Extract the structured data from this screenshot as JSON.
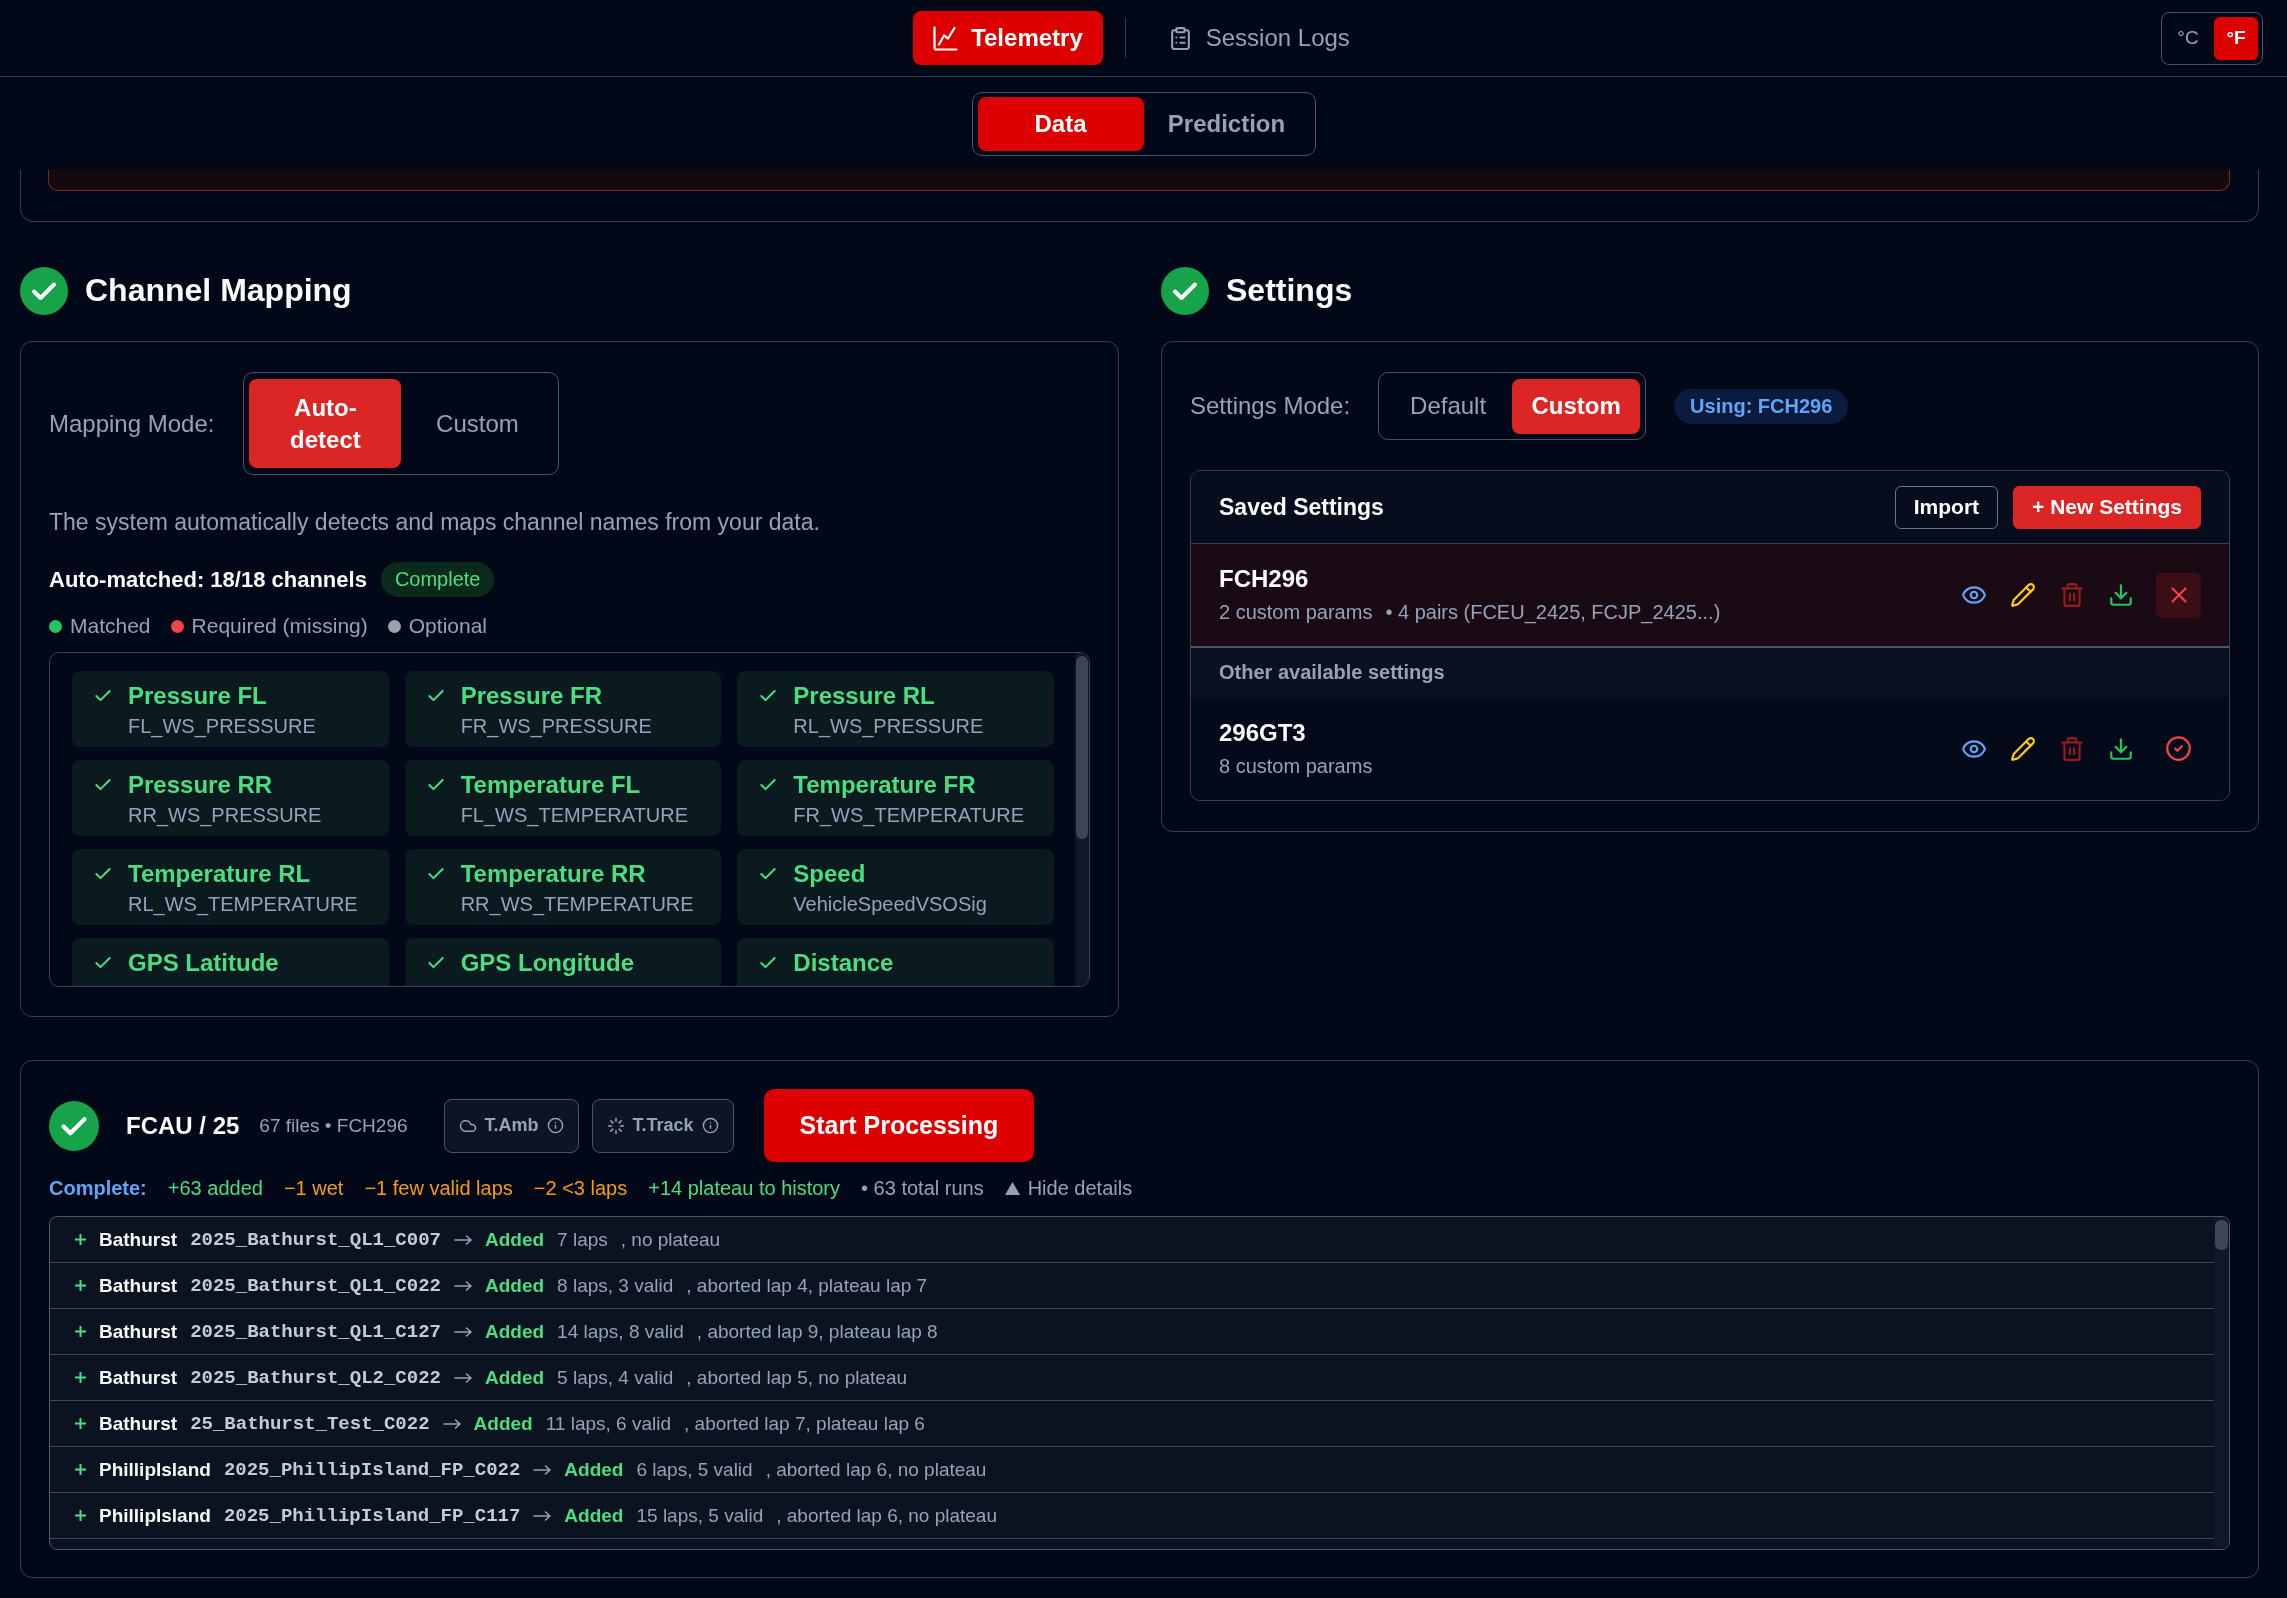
{
  "nav": [
    {
      "label": "Telemetry",
      "selected": true
    },
    {
      "label": "Session Logs",
      "selected": false
    }
  ],
  "units": [
    {
      "label": "°C",
      "selected": false
    },
    {
      "label": "°F",
      "selected": true
    }
  ],
  "view_tabs": [
    {
      "label": "Data",
      "selected": true
    },
    {
      "label": "Prediction",
      "selected": false
    }
  ],
  "channel_mapping": {
    "title": "Channel Mapping",
    "complete": true,
    "mode_label": "Mapping Mode:",
    "modes": [
      {
        "label": "Auto-detect",
        "selected": true
      },
      {
        "label": "Custom",
        "selected": false
      }
    ],
    "description": "The system automatically detects and maps channel names from your data.",
    "summary": "Auto-matched: 18/18 channels",
    "badge": "Complete",
    "legend": [
      {
        "label": "Matched",
        "color": "#22c55e"
      },
      {
        "label": "Required (missing)",
        "color": "#ef4444"
      },
      {
        "label": "Optional",
        "color": "#9ca3af"
      }
    ],
    "channels": [
      {
        "name": "Pressure FL",
        "source": "FL_WS_PRESSURE",
        "matched": true
      },
      {
        "name": "Pressure FR",
        "source": "FR_WS_PRESSURE",
        "matched": true
      },
      {
        "name": "Pressure RL",
        "source": "RL_WS_PRESSURE",
        "matched": true
      },
      {
        "name": "Pressure RR",
        "source": "RR_WS_PRESSURE",
        "matched": true
      },
      {
        "name": "Temperature FL",
        "source": "FL_WS_TEMPERATURE",
        "matched": true
      },
      {
        "name": "Temperature FR",
        "source": "FR_WS_TEMPERATURE",
        "matched": true
      },
      {
        "name": "Temperature RL",
        "source": "RL_WS_TEMPERATURE",
        "matched": true
      },
      {
        "name": "Temperature RR",
        "source": "RR_WS_TEMPERATURE",
        "matched": true
      },
      {
        "name": "Speed",
        "source": "VehicleSpeedVSOSig",
        "matched": true
      },
      {
        "name": "GPS Latitude",
        "matched": true
      },
      {
        "name": "GPS Longitude",
        "matched": true
      },
      {
        "name": "Distance",
        "matched": true
      }
    ]
  },
  "settings": {
    "title": "Settings",
    "complete": true,
    "mode_label": "Settings Mode:",
    "modes": [
      {
        "label": "Default",
        "selected": false
      },
      {
        "label": "Custom",
        "selected": true
      }
    ],
    "using": "Using: FCH296",
    "saved": {
      "title": "Saved Settings",
      "actions": [
        {
          "label": "Import",
          "kind": "outline"
        },
        {
          "label": "+ New Settings",
          "kind": "primary"
        }
      ],
      "current": [
        {
          "name": "FCH296",
          "params": "2 custom params",
          "pairs": "• 4 pairs (FCEU_2425, FCJP_2425...)",
          "selected": true
        }
      ],
      "others_label": "Other available settings",
      "others": [
        {
          "name": "296GT3",
          "params": "8 custom params",
          "selected": false
        }
      ]
    }
  },
  "processing": {
    "complete": true,
    "title": "FCAU / 25",
    "meta": "67 files • FCH296",
    "chips": [
      "T.Amb",
      "T.Track"
    ],
    "start": "Start Processing",
    "summary": [
      {
        "text": "Complete:",
        "kind": "label"
      },
      {
        "text": "+63 added",
        "kind": "gain"
      },
      {
        "text": "−1 wet",
        "kind": "loss"
      },
      {
        "text": "−1 few valid laps",
        "kind": "loss"
      },
      {
        "text": "−2 <3 laps",
        "kind": "loss"
      },
      {
        "text": "+14 plateau to history",
        "kind": "gain"
      },
      {
        "text": "• 63 total runs",
        "kind": "note"
      }
    ],
    "details_toggle": "Hide details",
    "expanded": true,
    "log": [
      {
        "track": "Bathurst",
        "file": "2025_Bathurst_QL1_C007",
        "status": "Added",
        "laps": "7 laps",
        "notes": ", no plateau"
      },
      {
        "track": "Bathurst",
        "file": "2025_Bathurst_QL1_C022",
        "status": "Added",
        "laps": "8 laps, 3 valid",
        "notes": ", aborted lap 4, plateau lap 7"
      },
      {
        "track": "Bathurst",
        "file": "2025_Bathurst_QL1_C127",
        "status": "Added",
        "laps": "14 laps, 8 valid",
        "notes": ", aborted lap 9, plateau lap 8"
      },
      {
        "track": "Bathurst",
        "file": "2025_Bathurst_QL2_C022",
        "status": "Added",
        "laps": "5 laps, 4 valid",
        "notes": ", aborted lap 5, no plateau"
      },
      {
        "track": "Bathurst",
        "file": "25_Bathurst_Test_C022",
        "status": "Added",
        "laps": "11 laps, 6 valid",
        "notes": ", aborted lap 7, plateau lap 6"
      },
      {
        "track": "PhillipIsland",
        "file": "2025_PhillipIsland_FP_C022",
        "status": "Added",
        "laps": "6 laps, 5 valid",
        "notes": ", aborted lap 6, no plateau"
      },
      {
        "track": "PhillipIsland",
        "file": "2025_PhillipIsland_FP_C117",
        "status": "Added",
        "laps": "15 laps, 5 valid",
        "notes": ", aborted lap 6, no plateau"
      }
    ]
  }
}
